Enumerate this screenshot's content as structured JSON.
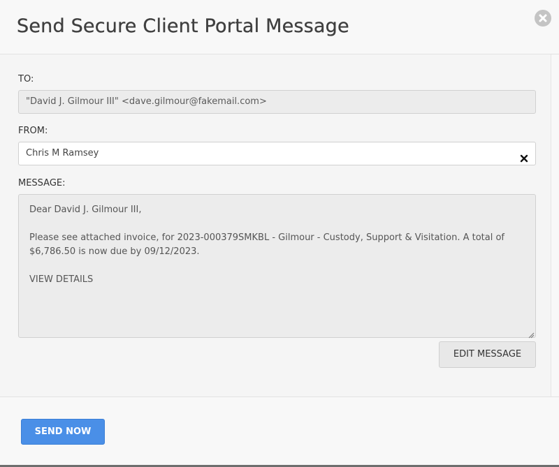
{
  "modal": {
    "title": "Send Secure Client Portal Message"
  },
  "fields": {
    "to_label": "TO:",
    "to_value": "\"David J. Gilmour III\" <dave.gilmour@fakemail.com>",
    "from_label": "FROM:",
    "from_value": "Chris M Ramsey",
    "message_label": "MESSAGE:"
  },
  "message": {
    "greeting": "Dear David J. Gilmour III,",
    "body": "Please see attached invoice, for 2023-000379SMKBL - Gilmour - Custody, Support & Visitation. A total of $6,786.50 is now due by 09/12/2023.",
    "link": "VIEW DETAILS"
  },
  "buttons": {
    "edit_message": "EDIT MESSAGE",
    "send_now": "SEND NOW"
  },
  "icons": {
    "close": "close-icon",
    "clear": "clear-icon",
    "resize": "resize-handle-icon"
  },
  "colors": {
    "primary": "#4a8fe7",
    "title": "#3f3f3f",
    "background": "#f5f5f5"
  }
}
